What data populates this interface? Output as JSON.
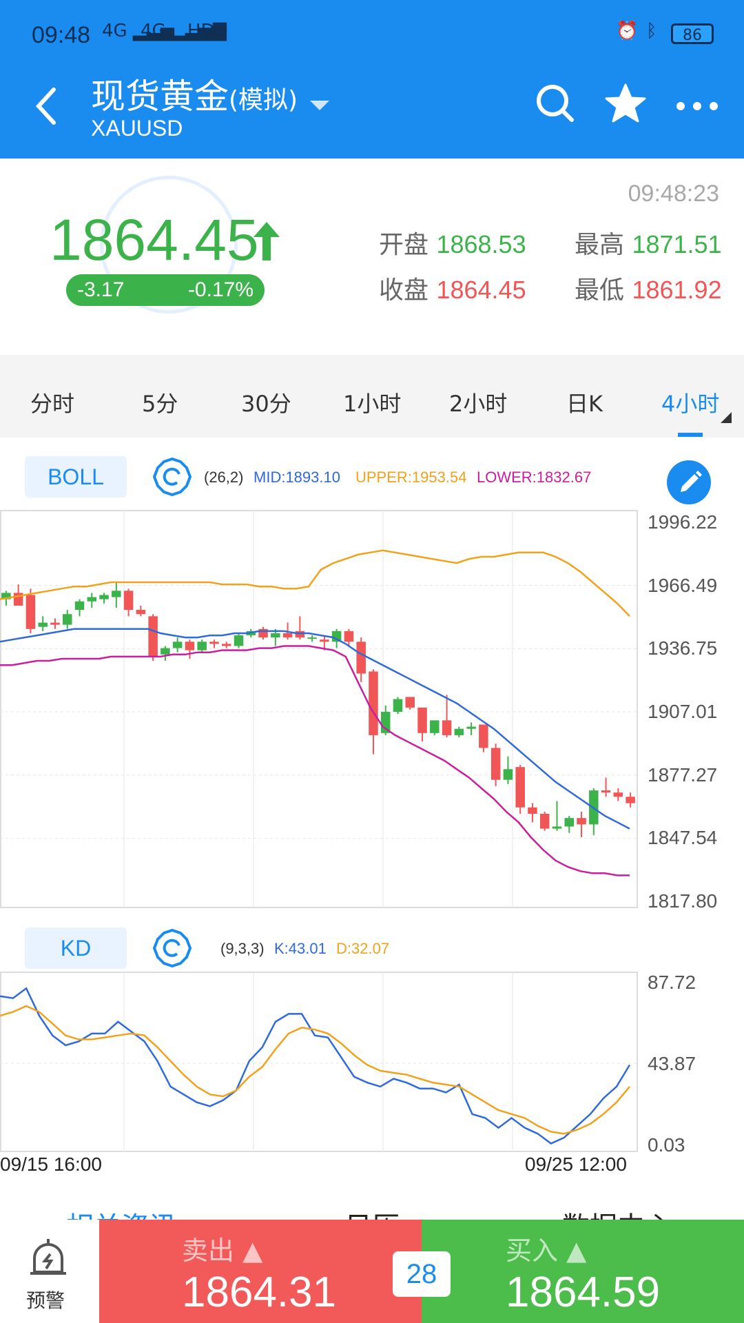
{
  "status_bar": {
    "time": "09:48",
    "net1": "4G",
    "net2": "4G",
    "hd": "HD",
    "battery": "86"
  },
  "header": {
    "title": "现货黄金",
    "title_suffix": "(模拟)",
    "symbol": "XAUUSD"
  },
  "quote": {
    "price": "1864.45",
    "change": "-3.17",
    "change_pct": "-0.17%",
    "time": "09:48:23",
    "open_label": "开盘",
    "open": "1868.53",
    "high_label": "最高",
    "high": "1871.51",
    "close_label": "收盘",
    "close": "1864.45",
    "low_label": "最低",
    "low": "1861.92"
  },
  "tabs": [
    {
      "label": "分时"
    },
    {
      "label": "5分"
    },
    {
      "label": "30分"
    },
    {
      "label": "1小时"
    },
    {
      "label": "2小时"
    },
    {
      "label": "日K"
    },
    {
      "label": "4小时",
      "active": true
    }
  ],
  "boll": {
    "name": "BOLL",
    "params": "(26,2)",
    "mid": "MID:1893.10",
    "upper": "UPPER:1953.54",
    "lower": "LOWER:1832.67"
  },
  "kd": {
    "name": "KD",
    "params": "(9,3,3)",
    "k": "K:43.01",
    "d": "D:32.07"
  },
  "colors": {
    "header": "#1a8cf0",
    "up": "#3cb34a",
    "down": "#f05656",
    "mid": "#2f6ad8",
    "upper": "#f0a21c",
    "lower": "#c81ea0"
  },
  "chart_data": [
    {
      "type": "candlestick",
      "title": "BOLL",
      "y_ticks": [
        "1996.22",
        "1966.49",
        "1936.75",
        "1907.01",
        "1877.27",
        "1847.54",
        "1817.80"
      ],
      "ylim": [
        1817.8,
        1996.22
      ],
      "x_labels": [
        "09/15 16:00",
        "09/25 12:00"
      ],
      "candles": [
        {
          "o": 1960,
          "h": 1964,
          "l": 1957,
          "c": 1963
        },
        {
          "o": 1963,
          "h": 1967,
          "l": 1959,
          "c": 1957
        },
        {
          "o": 1962,
          "h": 1965,
          "l": 1944,
          "c": 1946
        },
        {
          "o": 1947,
          "h": 1952,
          "l": 1945,
          "c": 1949
        },
        {
          "o": 1949,
          "h": 1951,
          "l": 1946,
          "c": 1948
        },
        {
          "o": 1948,
          "h": 1955,
          "l": 1946,
          "c": 1953
        },
        {
          "o": 1955,
          "h": 1960,
          "l": 1952,
          "c": 1959
        },
        {
          "o": 1959,
          "h": 1963,
          "l": 1956,
          "c": 1961
        },
        {
          "o": 1960,
          "h": 1963,
          "l": 1958,
          "c": 1962
        },
        {
          "o": 1961,
          "h": 1968,
          "l": 1956,
          "c": 1964
        },
        {
          "o": 1964,
          "h": 1965,
          "l": 1952,
          "c": 1955
        },
        {
          "o": 1955,
          "h": 1957,
          "l": 1952,
          "c": 1953
        },
        {
          "o": 1952,
          "h": 1953,
          "l": 1931,
          "c": 1933
        },
        {
          "o": 1934,
          "h": 1938,
          "l": 1931,
          "c": 1937
        },
        {
          "o": 1937,
          "h": 1942,
          "l": 1935,
          "c": 1940
        },
        {
          "o": 1940,
          "h": 1941,
          "l": 1932,
          "c": 1936
        },
        {
          "o": 1936,
          "h": 1941,
          "l": 1935,
          "c": 1940
        },
        {
          "o": 1940,
          "h": 1941,
          "l": 1937,
          "c": 1939
        },
        {
          "o": 1939,
          "h": 1940,
          "l": 1937,
          "c": 1938
        },
        {
          "o": 1938,
          "h": 1944,
          "l": 1937,
          "c": 1943
        },
        {
          "o": 1943,
          "h": 1946,
          "l": 1942,
          "c": 1945
        },
        {
          "o": 1946,
          "h": 1947,
          "l": 1941,
          "c": 1942
        },
        {
          "o": 1942,
          "h": 1946,
          "l": 1938,
          "c": 1944
        },
        {
          "o": 1944,
          "h": 1949,
          "l": 1941,
          "c": 1942
        },
        {
          "o": 1945,
          "h": 1952,
          "l": 1941,
          "c": 1942
        },
        {
          "o": 1942,
          "h": 1943,
          "l": 1940,
          "c": 1942
        },
        {
          "o": 1941,
          "h": 1943,
          "l": 1936,
          "c": 1940
        },
        {
          "o": 1940,
          "h": 1946,
          "l": 1937,
          "c": 1945
        },
        {
          "o": 1945,
          "h": 1946,
          "l": 1938,
          "c": 1940
        },
        {
          "o": 1940,
          "h": 1942,
          "l": 1921,
          "c": 1925
        },
        {
          "o": 1926,
          "h": 1927,
          "l": 1887,
          "c": 1896
        },
        {
          "o": 1897,
          "h": 1910,
          "l": 1896,
          "c": 1907
        },
        {
          "o": 1907,
          "h": 1914,
          "l": 1906,
          "c": 1913
        },
        {
          "o": 1914,
          "h": 1914,
          "l": 1908,
          "c": 1909
        },
        {
          "o": 1909,
          "h": 1909,
          "l": 1893,
          "c": 1897
        },
        {
          "o": 1897,
          "h": 1900,
          "l": 1896,
          "c": 1903
        },
        {
          "o": 1903,
          "h": 1915,
          "l": 1895,
          "c": 1896
        },
        {
          "o": 1896,
          "h": 1900,
          "l": 1895,
          "c": 1899
        },
        {
          "o": 1899,
          "h": 1902,
          "l": 1896,
          "c": 1900
        },
        {
          "o": 1901,
          "h": 1901,
          "l": 1888,
          "c": 1890
        },
        {
          "o": 1890,
          "h": 1892,
          "l": 1872,
          "c": 1875
        },
        {
          "o": 1875,
          "h": 1886,
          "l": 1873,
          "c": 1880
        },
        {
          "o": 1881,
          "h": 1882,
          "l": 1859,
          "c": 1862
        },
        {
          "o": 1862,
          "h": 1864,
          "l": 1855,
          "c": 1859
        },
        {
          "o": 1859,
          "h": 1860,
          "l": 1851,
          "c": 1852
        },
        {
          "o": 1852,
          "h": 1865,
          "l": 1851,
          "c": 1853
        },
        {
          "o": 1853,
          "h": 1858,
          "l": 1850,
          "c": 1857
        },
        {
          "o": 1857,
          "h": 1860,
          "l": 1848,
          "c": 1854
        },
        {
          "o": 1854,
          "h": 1871,
          "l": 1849,
          "c": 1870
        },
        {
          "o": 1870,
          "h": 1876,
          "l": 1867,
          "c": 1869
        },
        {
          "o": 1869,
          "h": 1871,
          "l": 1865,
          "c": 1867
        },
        {
          "o": 1867,
          "h": 1869,
          "l": 1862,
          "c": 1864
        }
      ],
      "series": [
        {
          "name": "MID",
          "values": [
            1940,
            1941,
            1942,
            1943,
            1944,
            1945,
            1946,
            1946,
            1946,
            1946,
            1946,
            1946,
            1946,
            1944,
            1943,
            1942,
            1942,
            1943,
            1943,
            1944,
            1944,
            1945,
            1945,
            1945,
            1944,
            1944,
            1943,
            1942,
            1939,
            1935,
            1932,
            1929,
            1926,
            1923,
            1920,
            1917,
            1914,
            1911,
            1907,
            1903,
            1899,
            1894,
            1889,
            1884,
            1879,
            1874,
            1870,
            1866,
            1862,
            1858,
            1855,
            1852
          ]
        },
        {
          "name": "UPPER",
          "values": [
            1960,
            1961,
            1962,
            1963,
            1964,
            1965,
            1966,
            1966,
            1967,
            1968,
            1968,
            1968,
            1968,
            1968,
            1968,
            1968,
            1968,
            1968,
            1967,
            1967,
            1967,
            1966,
            1966,
            1965,
            1965,
            1966,
            1974,
            1977,
            1979,
            1981,
            1982,
            1983,
            1982,
            1981,
            1980,
            1979,
            1978,
            1977,
            1979,
            1980,
            1980,
            1981,
            1982,
            1982,
            1982,
            1980,
            1977,
            1973,
            1968,
            1963,
            1958,
            1952
          ]
        },
        {
          "name": "LOWER",
          "values": [
            1929,
            1929,
            1930,
            1931,
            1931,
            1932,
            1932,
            1932,
            1932,
            1933,
            1933,
            1933,
            1933,
            1933,
            1934,
            1934,
            1935,
            1935,
            1936,
            1936,
            1936,
            1937,
            1937,
            1938,
            1938,
            1938,
            1937,
            1936,
            1933,
            1921,
            1909,
            1900,
            1896,
            1893,
            1890,
            1887,
            1884,
            1880,
            1876,
            1871,
            1866,
            1860,
            1855,
            1848,
            1842,
            1837,
            1834,
            1832,
            1831,
            1831,
            1830,
            1830
          ]
        }
      ]
    },
    {
      "type": "line",
      "title": "KD",
      "y_ticks": [
        "87.72",
        "43.87",
        "0.03"
      ],
      "ylim": [
        0.03,
        87.72
      ],
      "x_labels": [
        "09/15 16:00",
        "09/25 12:00"
      ],
      "series": [
        {
          "name": "K",
          "values": [
            78,
            77,
            82,
            68,
            58,
            53,
            55,
            59,
            59,
            65,
            60,
            55,
            45,
            32,
            28,
            24,
            22,
            25,
            30,
            45,
            52,
            65,
            69,
            69,
            58,
            57,
            47,
            37,
            34,
            32,
            36,
            34,
            31,
            31,
            29,
            33,
            18,
            16,
            11,
            16,
            11,
            8,
            3,
            6,
            12,
            18,
            26,
            32,
            43
          ]
        },
        {
          "name": "D",
          "values": [
            68,
            70,
            73,
            70,
            64,
            58,
            56,
            56,
            57,
            58,
            59,
            58,
            52,
            45,
            38,
            32,
            28,
            27,
            30,
            37,
            42,
            51,
            59,
            62,
            61,
            59,
            54,
            48,
            43,
            40,
            39,
            38,
            36,
            34,
            33,
            32,
            28,
            24,
            20,
            18,
            16,
            12,
            9,
            8,
            10,
            13,
            18,
            24,
            32
          ]
        }
      ]
    }
  ],
  "bottom": {
    "alert_label": "预警",
    "sell_label": "卖出",
    "sell_price": "1864.31",
    "spread": "28",
    "buy_label": "买入",
    "buy_price": "1864.59"
  },
  "cutoff_tabs": [
    "相关资讯",
    "日历",
    "数据中心"
  ]
}
